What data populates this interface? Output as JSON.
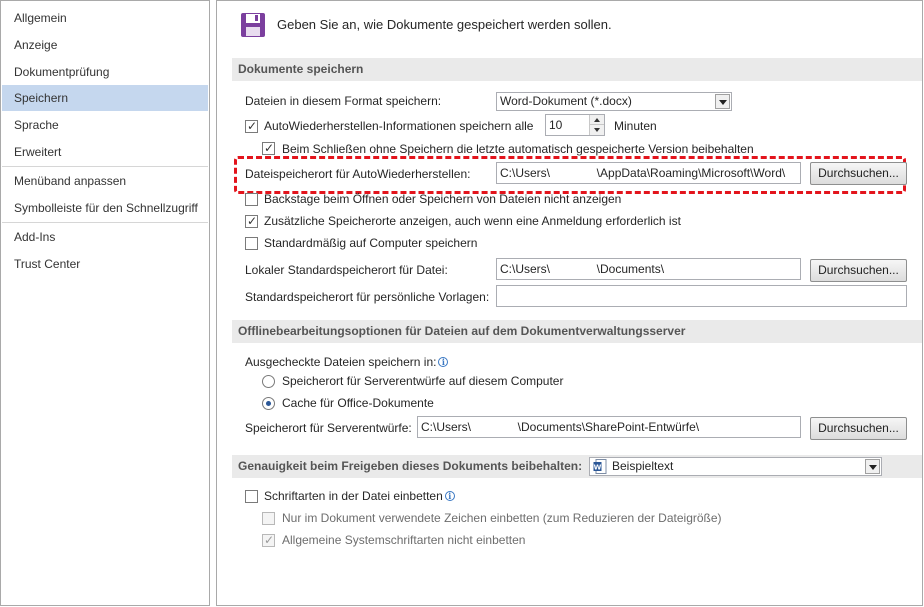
{
  "nav": {
    "items": [
      {
        "label": "Allgemein"
      },
      {
        "label": "Anzeige"
      },
      {
        "label": "Dokumentprüfung"
      },
      {
        "label": "Speichern"
      },
      {
        "label": "Sprache"
      },
      {
        "label": "Erweitert"
      },
      {
        "label": "Menüband anpassen"
      },
      {
        "label": "Symbolleiste für den Schnellzugriff"
      },
      {
        "label": "Add-Ins"
      },
      {
        "label": "Trust Center"
      }
    ],
    "selected": "Speichern"
  },
  "header": {
    "icon": "save-disk-icon",
    "text": "Geben Sie an, wie Dokumente gespeichert werden sollen."
  },
  "section_save": {
    "title": "Dokumente speichern",
    "format_label": "Dateien in diesem Format speichern:",
    "format_value": "Word-Dokument (*.docx)",
    "autorecover_label": "AutoWiederherstellen-Informationen speichern alle",
    "autorecover_checked": true,
    "autorecover_minutes": "10",
    "minutes_label": "Minuten",
    "keep_last_label": "Beim Schließen ohne Speichern die letzte automatisch gespeicherte Version beibehalten",
    "keep_last_checked": true,
    "autorecover_location_label": "Dateispeicherort für AutoWiederherstellen:",
    "autorecover_location_value": "C:\\Users\\              \\AppData\\Roaming\\Microsoft\\Word\\",
    "browse_label": "Durchsuchen...",
    "backstage_label": "Backstage beim Öffnen oder Speichern von Dateien nicht anzeigen",
    "backstage_checked": false,
    "additional_locations_label": "Zusätzliche Speicherorte anzeigen, auch wenn eine Anmeldung erforderlich ist",
    "additional_locations_checked": true,
    "default_computer_label": "Standardmäßig auf Computer speichern",
    "default_computer_checked": false,
    "local_default_label": "Lokaler Standardspeicherort für Datei:",
    "local_default_value": "C:\\Users\\              \\Documents\\",
    "templates_label": "Standardspeicherort für persönliche Vorlagen:",
    "templates_value": ""
  },
  "section_offline": {
    "title": "Offlinebearbeitungsoptionen für Dateien auf dem Dokumentverwaltungsserver",
    "checked_out_label": "Ausgecheckte Dateien speichern in:",
    "radio_server_label": "Speicherort für Serverentwürfe auf diesem Computer",
    "radio_cache_label": "Cache für Office-Dokumente",
    "selected_radio": "cache",
    "drafts_label": "Speicherort für Serverentwürfe:",
    "drafts_value": "C:\\Users\\              \\Documents\\SharePoint-Entwürfe\\",
    "browse_label": "Durchsuchen..."
  },
  "section_fidelity": {
    "title": "Genauigkeit beim Freigeben dieses Dokuments beibehalten:",
    "document_value": "Beispieltext",
    "embed_fonts_label": "Schriftarten in der Datei einbetten",
    "embed_fonts_checked": false,
    "embed_used_label": "Nur im Dokument verwendete Zeichen einbetten (zum Reduzieren der Dateigröße)",
    "embed_used_checked": false,
    "no_system_fonts_label": "Allgemeine Systemschriftarten nicht einbetten",
    "no_system_fonts_checked": true
  },
  "colors": {
    "nav_selected": "#c5d7ee",
    "highlight": "#e3141c",
    "save_icon": "#7b3f9e"
  }
}
